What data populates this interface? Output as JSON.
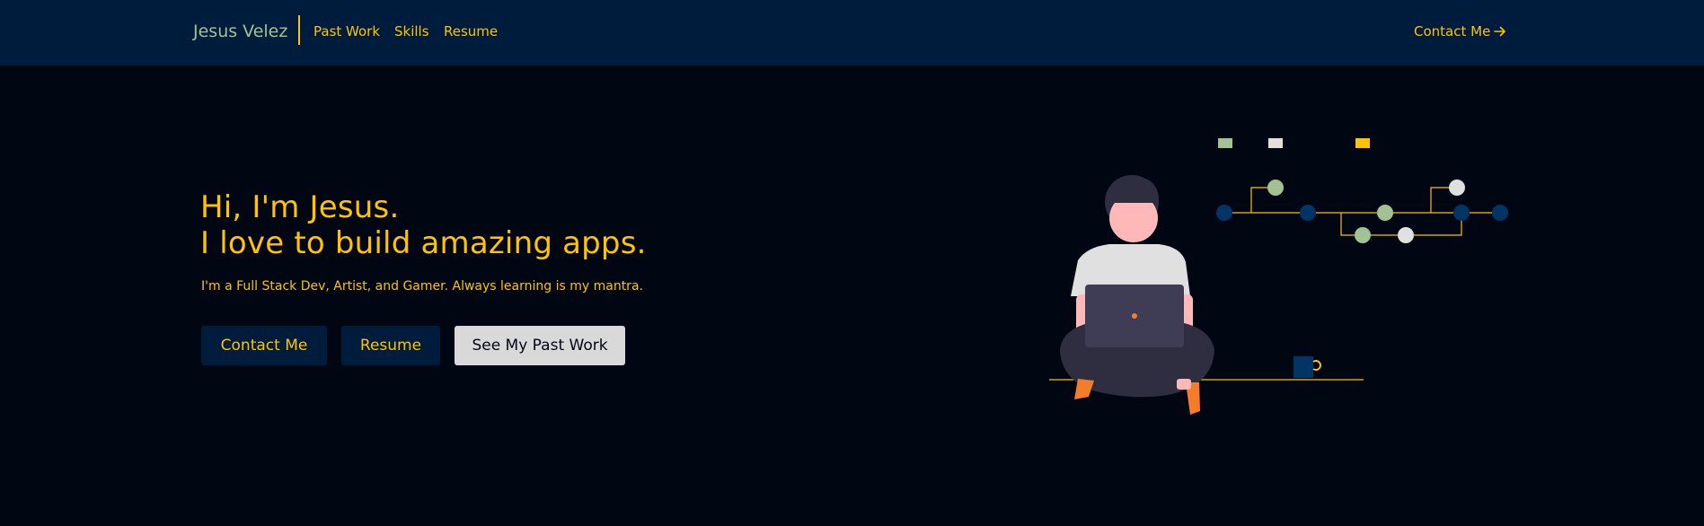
{
  "navbar": {
    "brand": "Jesus Velez",
    "links": [
      {
        "label": "Past Work"
      },
      {
        "label": "Skills"
      },
      {
        "label": "Resume"
      }
    ],
    "contact_label": "Contact Me"
  },
  "hero": {
    "title_line_1": "Hi, I'm Jesus.",
    "title_line_2": "I love to build amazing apps.",
    "subtitle": "I'm a Full Stack Dev, Artist, and Gamer. Always learning is my mantra.",
    "buttons": {
      "contact": "Contact Me",
      "resume": "Resume",
      "past_work": "See My Past Work"
    }
  },
  "theme": {
    "background": "#000713",
    "navbar_bg": "#001c3d",
    "accent": "#ffc300",
    "brand_text": "#a3c293",
    "light_button": "#d9d9d9"
  },
  "icons": {
    "contact_arrow": "arrow-right-icon"
  }
}
